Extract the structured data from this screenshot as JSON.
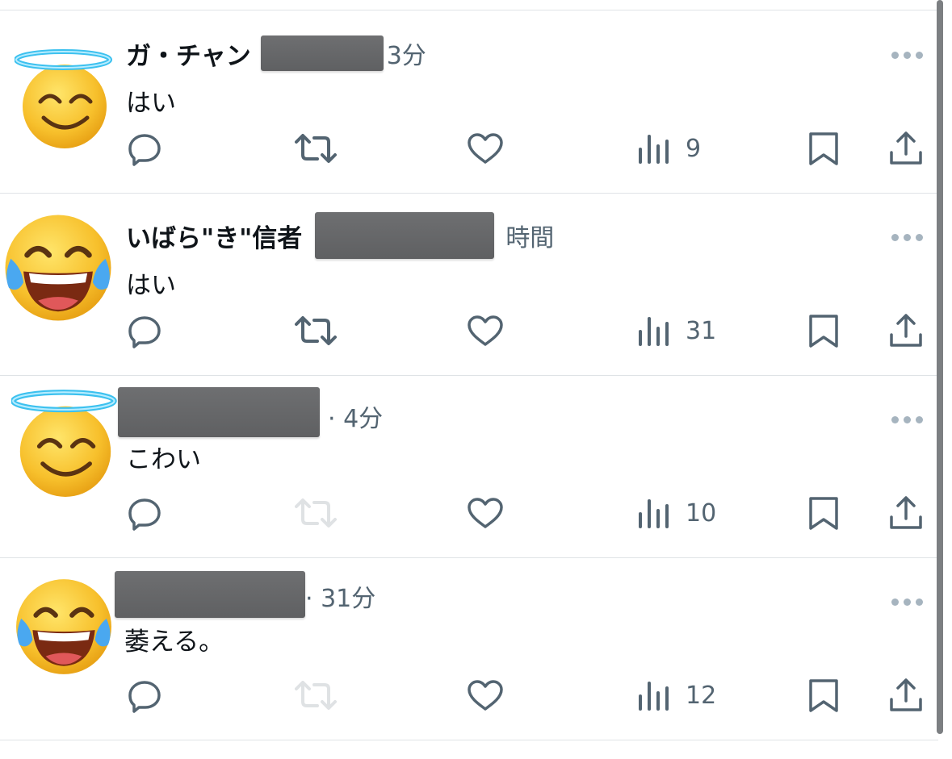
{
  "posts": [
    {
      "avatar": "smiling-face-with-halo",
      "name": "ガ・チャン",
      "time": "3分",
      "text": "はい",
      "views": "9",
      "repost_disabled": false
    },
    {
      "avatar": "face-with-tears-of-joy",
      "name": "いばら\"き\"信者",
      "time": "時間",
      "text": "はい",
      "views": "31",
      "repost_disabled": false
    },
    {
      "avatar": "smiling-face-with-halo",
      "name": "",
      "time": "· 4分",
      "text": "こわい",
      "views": "10",
      "repost_disabled": true
    },
    {
      "avatar": "face-with-tears-of-joy",
      "name": "",
      "time": "· 31分",
      "text": "萎える。",
      "views": "12",
      "repost_disabled": true
    }
  ],
  "icons": {
    "reply": "reply-icon",
    "repost": "repost-icon",
    "like": "like-icon",
    "views": "views-icon",
    "bookmark": "bookmark-icon",
    "share": "share-icon",
    "more": "more-icon"
  },
  "colors": {
    "text": "#0f1419",
    "secondary": "#536471",
    "icon": "#536471",
    "divider": "#dfe3e6",
    "redaction": "#666769"
  }
}
